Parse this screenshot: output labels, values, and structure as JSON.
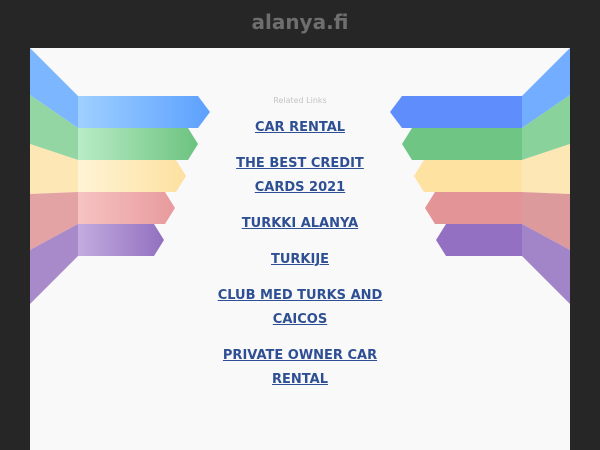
{
  "header": {
    "title": "alanya.fi"
  },
  "related": {
    "label": "Related Links",
    "links": [
      {
        "label": "CAR RENTAL"
      },
      {
        "label": "THE BEST CREDIT CARDS 2021"
      },
      {
        "label": "TURKKI ALANYA"
      },
      {
        "label": "TURKIJE"
      },
      {
        "label": "CLUB MED TURKS AND CAICOS"
      },
      {
        "label": "PRIVATE OWNER CAR RENTAL"
      }
    ]
  },
  "colors": {
    "background": "#262626",
    "panel": "#f9f9f9",
    "link": "#2e4f93",
    "ribbons": [
      "#62a3ff",
      "#76c98a",
      "#fde3a4",
      "#eaa0a2",
      "#9b7dc6"
    ]
  }
}
